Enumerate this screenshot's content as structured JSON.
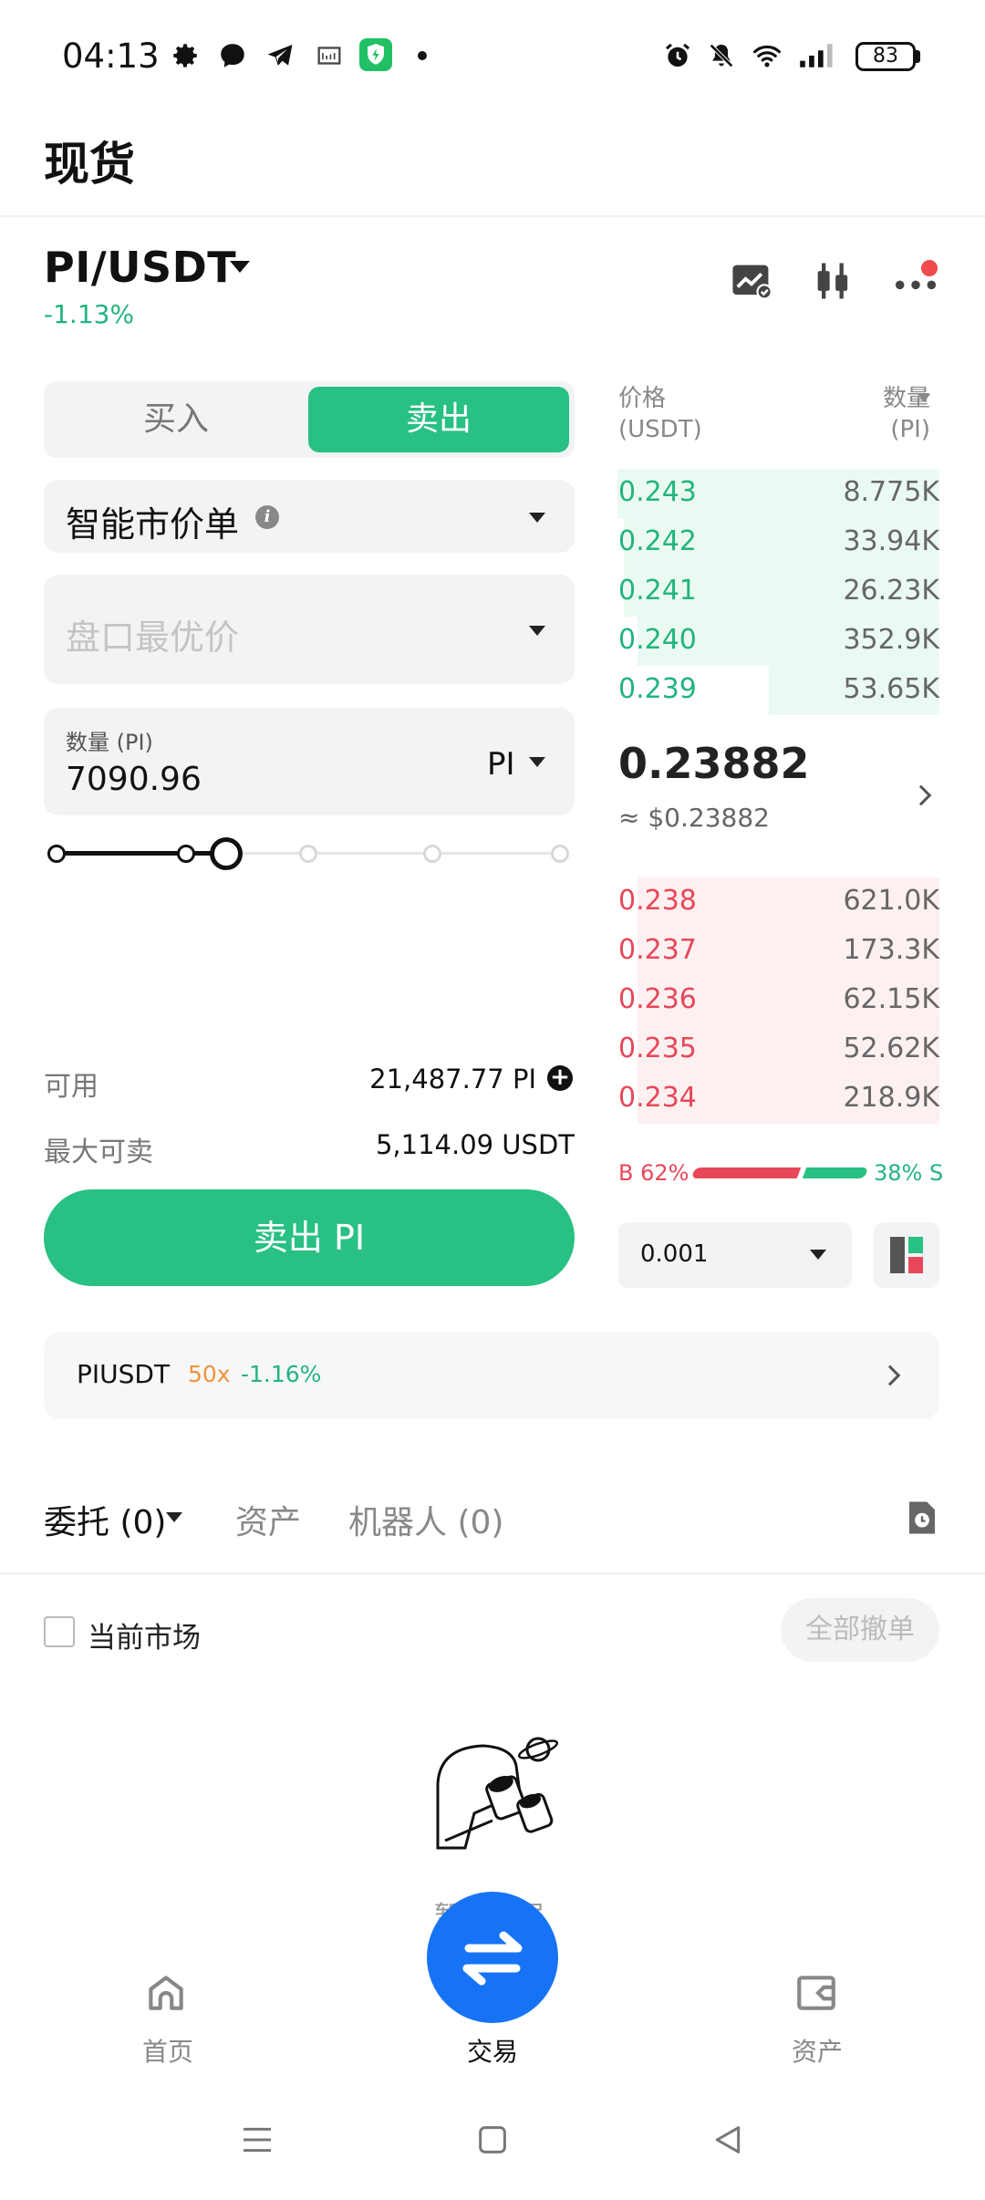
{
  "status_bar": {
    "time": "04:13",
    "battery": "83",
    "icons": [
      "gear-icon",
      "messenger-icon",
      "telegram-icon",
      "gallery-icon",
      "shield-app-icon",
      "dot-icon",
      "alarm-icon",
      "bell-off-icon",
      "wifi-icon",
      "signal-icon",
      "battery-icon"
    ]
  },
  "header": {
    "title": "现货"
  },
  "pair": {
    "symbol": "PI/USDT",
    "change": "-1.13%",
    "icons": [
      "chart-settings-icon",
      "candlestick-icon",
      "more-icon"
    ]
  },
  "trade": {
    "buy_label": "买入",
    "sell_label": "卖出",
    "selected_side": "sell",
    "order_type": "智能市价单",
    "price_placeholder": "盘口最优价",
    "quantity_label": "数量 (PI)",
    "quantity_value": "7090.96",
    "quantity_unit": "PI",
    "slider_percent": 33,
    "available_label": "可用",
    "available_value": "21,487.77 PI",
    "max_sell_label": "最大可卖",
    "max_sell_value": "5,114.09 USDT",
    "submit_label": "卖出 PI"
  },
  "orderbook": {
    "price_header": "价格",
    "price_unit": "(USDT)",
    "qty_header": "数量",
    "qty_unit": "(PI)",
    "asks": [
      {
        "price": "0.243",
        "qty": "8.775K",
        "depth": 0.98
      },
      {
        "price": "0.242",
        "qty": "33.94K",
        "depth": 0.96
      },
      {
        "price": "0.241",
        "qty": "26.23K",
        "depth": 0.96
      },
      {
        "price": "0.240",
        "qty": "352.9K",
        "depth": 0.92
      },
      {
        "price": "0.239",
        "qty": "53.65K",
        "depth": 0.52
      }
    ],
    "last_price": "0.23882",
    "last_price_usd": "≈ $0.23882",
    "bids": [
      {
        "price": "0.238",
        "qty": "621.0K",
        "depth": 0.92
      },
      {
        "price": "0.237",
        "qty": "173.3K",
        "depth": 0.92
      },
      {
        "price": "0.236",
        "qty": "62.15K",
        "depth": 0.92
      },
      {
        "price": "0.235",
        "qty": "52.62K",
        "depth": 0.92
      },
      {
        "price": "0.234",
        "qty": "218.9K",
        "depth": 0.92
      }
    ],
    "buy_ratio_label": "B 62%",
    "sell_ratio_label": "38% S",
    "buy_ratio": 62,
    "sell_ratio": 38,
    "precision": "0.001"
  },
  "perp_banner": {
    "name": "PIUSDT",
    "leverage": "50x",
    "change": "-1.16%"
  },
  "orders": {
    "tabs": [
      {
        "label": "委托 (0)",
        "active": true
      },
      {
        "label": "资产",
        "active": false
      },
      {
        "label": "机器人 (0)",
        "active": false
      }
    ],
    "current_market_label": "当前市场",
    "cancel_all_label": "全部撤单",
    "empty_text": "暂无数据"
  },
  "bottom_nav": {
    "items": [
      {
        "label": "首页",
        "icon": "home-icon"
      },
      {
        "label": "交易",
        "icon": "swap-icon"
      },
      {
        "label": "资产",
        "icon": "wallet-icon"
      }
    ]
  },
  "system_nav": [
    "menu-icon",
    "home-square-icon",
    "back-icon"
  ],
  "colors": {
    "green": "#28c083",
    "red": "#e8475a",
    "blue": "#1673f5",
    "orange": "#f0923a"
  }
}
